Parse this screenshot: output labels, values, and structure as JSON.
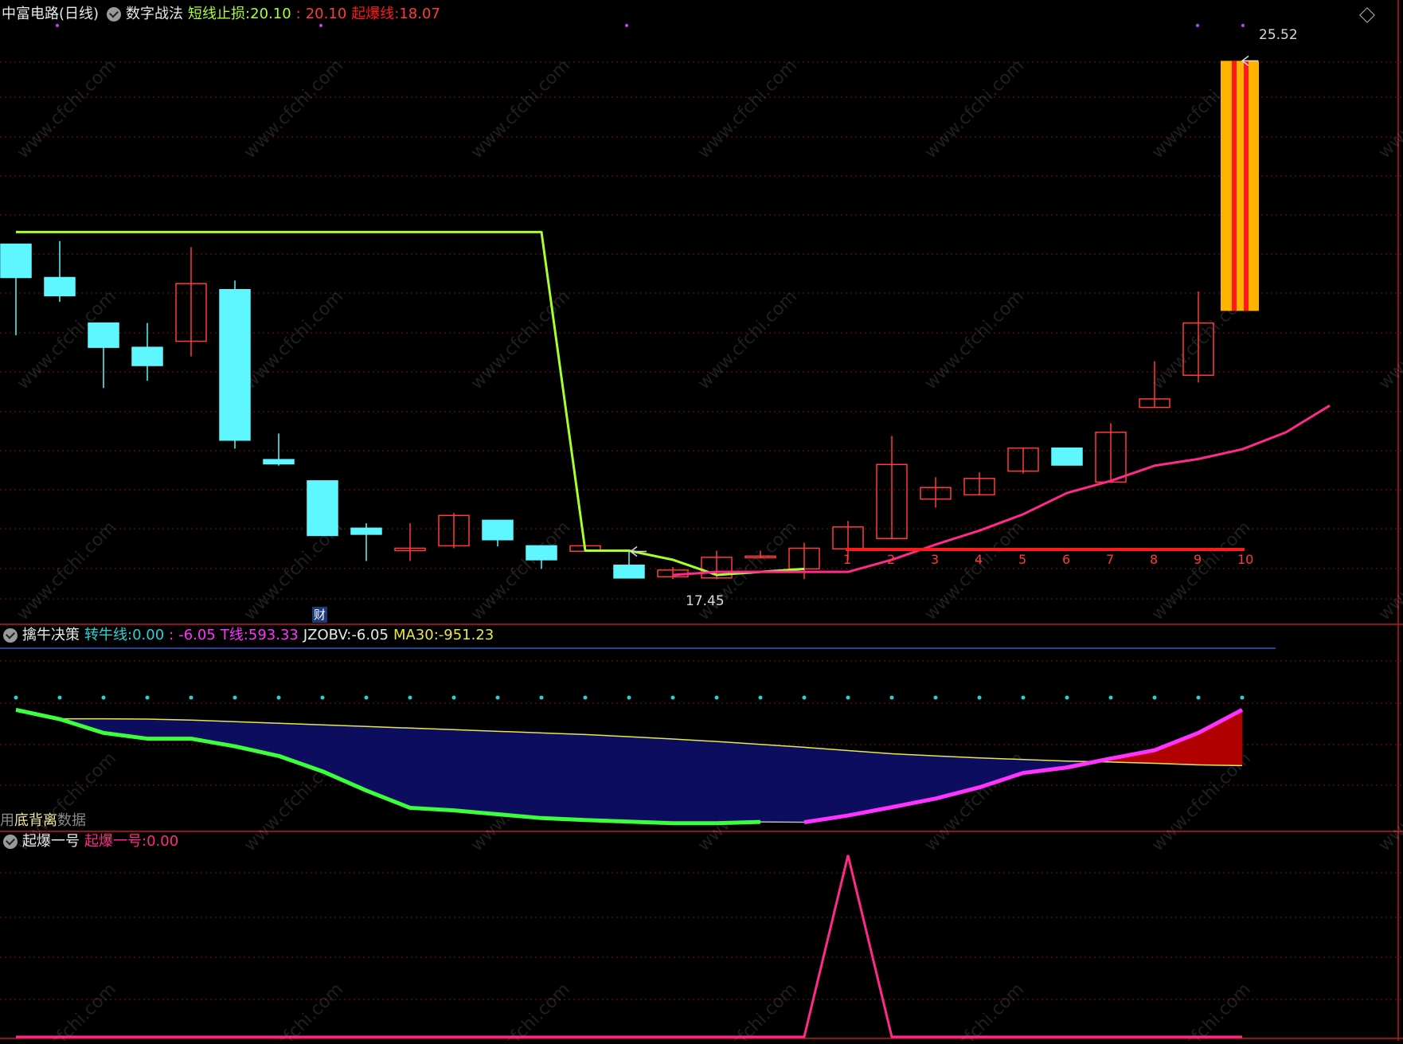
{
  "colors": {
    "bg": "#000000",
    "grid": "#7a1010",
    "divider": "#c01a1a",
    "up": "#ff3b3b",
    "down": "#5ef7ff",
    "short_stop": "#a8ff2e",
    "ma": "#ff2a8a",
    "surge_line": "#ff1a1a",
    "bar_orange": "#ffb300",
    "bar_red": "#ff1a1a",
    "fill_blue": "#0c0d5e",
    "fill_red": "#b00000",
    "green_line": "#3cff3c",
    "magenta_line": "#ff33ff",
    "yellow_line": "#e8e84a",
    "cyan_dot": "#27d3d3",
    "blue_hline": "#2a5bd0",
    "pink_line": "#ff2a8a"
  },
  "panel1": {
    "stock": "中富电路(日线)",
    "indicator": "数字战法",
    "short_stop_label": "短线止损:",
    "short_stop_value": "20.10",
    "sep": ":",
    "value2": "20.10",
    "surge_label": "起爆线:",
    "surge_value": "18.07",
    "high_marker": "25.52",
    "low_marker": "17.45",
    "finance_tag": "财",
    "counts": [
      "1",
      "2",
      "3",
      "4",
      "5",
      "6",
      "7",
      "8",
      "9",
      "10"
    ]
  },
  "panel2": {
    "indicator": "擒牛决策",
    "bull_label": "转牛线:",
    "bull_value": "0.00",
    "sep": ":",
    "value2": "-6.05",
    "t_label": "T线:",
    "t_value": "593.33",
    "jzobv_label": "JZOBV:",
    "jzobv_value": "-6.05",
    "ma30_label": "MA30:",
    "ma30_value": "-951.23",
    "footer_prefix": "用",
    "footer_suffix": "数据",
    "divergence_label": "底背离"
  },
  "panel3": {
    "indicator": "起爆一号",
    "label": "起爆一号:",
    "value": "0.00"
  },
  "watermark": "www.cfchi.com",
  "chart_data": [
    {
      "type": "candlestick",
      "title": "数字战法",
      "candles": [
        {
          "o": 22.5,
          "h": 22.5,
          "l": 21.0,
          "c": 21.95
        },
        {
          "o": 21.95,
          "h": 22.55,
          "l": 21.55,
          "c": 21.65
        },
        {
          "o": 21.2,
          "h": 21.2,
          "l": 20.13,
          "c": 20.8
        },
        {
          "o": 20.8,
          "h": 21.2,
          "l": 20.25,
          "c": 20.5
        },
        {
          "o": 20.9,
          "h": 22.45,
          "l": 20.65,
          "c": 21.85
        },
        {
          "o": 21.75,
          "h": 21.9,
          "l": 19.13,
          "c": 19.27
        },
        {
          "o": 18.95,
          "h": 19.38,
          "l": 18.85,
          "c": 18.88
        },
        {
          "o": 18.6,
          "h": 18.6,
          "l": 17.88,
          "c": 17.7
        },
        {
          "o": 17.82,
          "h": 17.9,
          "l": 17.28,
          "c": 17.72
        },
        {
          "o": 17.45,
          "h": 17.9,
          "l": 17.28,
          "c": 17.49
        },
        {
          "o": 17.53,
          "h": 18.07,
          "l": 17.49,
          "c": 18.03
        },
        {
          "o": 17.95,
          "h": 17.95,
          "l": 17.52,
          "c": 17.63
        },
        {
          "o": 17.53,
          "h": 17.53,
          "l": 17.15,
          "c": 17.3
        },
        {
          "o": 17.44,
          "h": 17.53,
          "l": 17.45,
          "c": 17.53
        },
        {
          "o": 17.21,
          "h": 17.43,
          "l": 17.07,
          "c": 17.0
        },
        {
          "o": 17.02,
          "h": 17.18,
          "l": 16.98,
          "c": 17.13
        },
        {
          "o": 17.0,
          "h": 17.45,
          "l": 16.98,
          "c": 17.34
        },
        {
          "o": 17.35,
          "h": 17.45,
          "l": 17.34,
          "c": 17.36
        },
        {
          "o": 17.15,
          "h": 17.58,
          "l": 16.98,
          "c": 17.49
        },
        {
          "o": 17.48,
          "h": 17.94,
          "l": 17.3,
          "c": 17.84
        },
        {
          "o": 17.65,
          "h": 19.34,
          "l": 17.65,
          "c": 18.87
        },
        {
          "o": 18.3,
          "h": 18.66,
          "l": 18.16,
          "c": 18.49
        },
        {
          "o": 18.37,
          "h": 18.74,
          "l": 18.37,
          "c": 18.64
        },
        {
          "o": 18.76,
          "h": 19.15,
          "l": 18.72,
          "c": 19.14
        },
        {
          "o": 19.14,
          "h": 19.14,
          "l": 18.86,
          "c": 18.86
        },
        {
          "o": 18.58,
          "h": 19.55,
          "l": 18.58,
          "c": 19.4
        },
        {
          "o": 19.81,
          "h": 20.57,
          "l": 19.81,
          "c": 19.95
        },
        {
          "o": 20.34,
          "h": 21.72,
          "l": 20.22,
          "c": 21.2
        }
      ],
      "short_stop_line": [
        22.7,
        22.7,
        22.7,
        22.7,
        22.7,
        22.7,
        22.7,
        22.7,
        22.7,
        22.7,
        22.7,
        22.7,
        22.7,
        17.45,
        17.45,
        17.3,
        17.05,
        17.1,
        17.15
      ],
      "ma_line": [
        17.05,
        17.1,
        17.1,
        17.1,
        17.1,
        17.3,
        17.55,
        17.78,
        18.05,
        18.4,
        18.6,
        18.85,
        18.96,
        19.12,
        19.4,
        19.84
      ],
      "surge_line_value": 17.47,
      "surge_bar": {
        "from": 21.4,
        "to": 25.52
      },
      "high": 25.52,
      "low": 17.45,
      "ylim": [
        16.0,
        26.05
      ]
    },
    {
      "type": "line",
      "title": "擒牛决策",
      "series": [
        {
          "name": "JZOBV",
          "values": [
            0.42,
            0.13,
            -0.3,
            -0.48,
            -0.48,
            -0.72,
            -1.02,
            -1.5,
            -2.1,
            -2.64,
            -2.72,
            -2.84,
            -2.96,
            -3.02,
            -3.07,
            -3.12,
            -3.12,
            -3.08,
            -3.09,
            -2.88,
            -2.62,
            -2.35,
            -2.0,
            -1.55,
            -1.38,
            -1.1,
            -0.84,
            -0.3,
            0.42
          ]
        },
        {
          "name": "MA30",
          "values": [
            0.42,
            0.14,
            0.14,
            0.13,
            0.1,
            0.05,
            0.0,
            -0.05,
            -0.1,
            -0.15,
            -0.2,
            -0.25,
            -0.3,
            -0.35,
            -0.42,
            -0.49,
            -0.57,
            -0.66,
            -0.75,
            -0.85,
            -0.95,
            -1.02,
            -1.08,
            -1.13,
            -1.18,
            -1.21,
            -1.25,
            -1.3,
            -1.32
          ]
        },
        {
          "name": "转牛线",
          "values": [
            0.0
          ]
        }
      ],
      "ylim": [
        -3.4,
        1.2
      ]
    },
    {
      "type": "line",
      "title": "起爆一号",
      "series": [
        {
          "name": "起爆一号",
          "values": [
            0,
            0,
            0,
            0,
            0,
            0,
            0,
            0,
            0,
            0,
            0,
            0,
            0,
            0,
            0,
            0,
            0,
            0,
            0,
            1,
            0,
            0,
            0,
            0,
            0,
            0,
            0,
            0,
            0
          ]
        }
      ],
      "ylim": [
        0,
        1
      ]
    }
  ]
}
